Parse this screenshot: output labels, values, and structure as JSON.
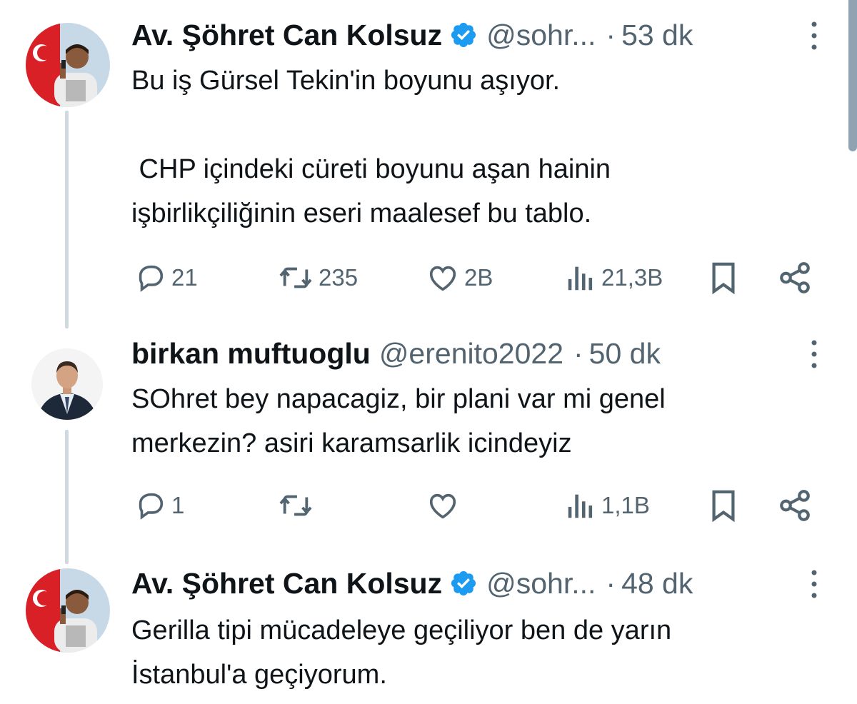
{
  "tweets": [
    {
      "name": "Av. Şöhret Can Kolsuz",
      "handle": "@sohr...",
      "separator": "·",
      "time": "53 dk",
      "body_lines": [
        "Bu iş Gürsel Tekin'in boyunu aşıyor.",
        "",
        " CHP içindeki cüreti boyunu aşan hainin",
        "işbirlikçiliğinin eseri maalesef bu tablo."
      ],
      "stats": {
        "replies": "21",
        "reposts": "235",
        "likes": "2B",
        "views": "21,3B"
      }
    },
    {
      "name": "birkan muftuoglu",
      "handle": "@erenito2022",
      "separator": "·",
      "time": "50 dk",
      "body_lines": [
        "SOhret bey napacagiz, bir plani var mi genel",
        "merkezin? asiri karamsarlik icindeyiz"
      ],
      "stats": {
        "replies": "1",
        "reposts": "",
        "likes": "",
        "views": "1,1B"
      }
    },
    {
      "name": "Av. Şöhret Can Kolsuz",
      "handle": "@sohr...",
      "separator": "·",
      "time": "48 dk",
      "body_lines": [
        "Gerilla tipi mücadeleye geçiliyor ben de yarın",
        "İstanbul'a geçiyorum."
      ]
    }
  ],
  "icons": {
    "verified": "verified-badge-icon",
    "more": "more-vertical-icon",
    "reply": "reply-icon",
    "repost": "repost-icon",
    "like": "like-icon",
    "views": "views-icon",
    "bookmark": "bookmark-icon",
    "share": "share-icon"
  },
  "colors": {
    "text": "#0f1419",
    "secondary": "#536471",
    "verified": "#1d9bf0",
    "thread_line": "#cfd9de"
  }
}
